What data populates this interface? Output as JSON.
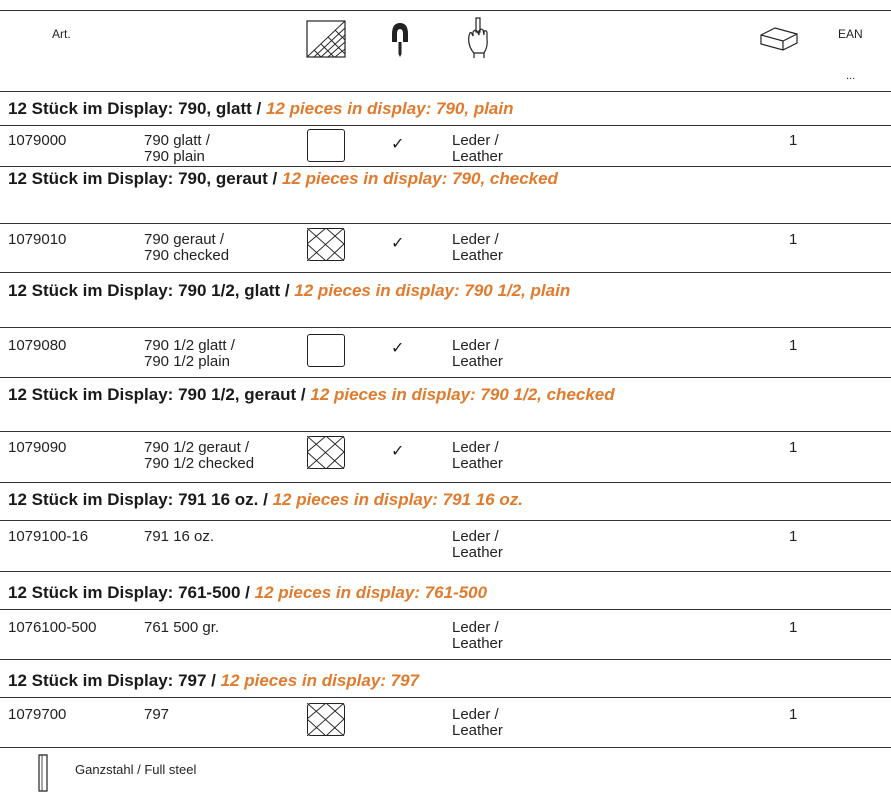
{
  "header": {
    "art_label": "Art.",
    "ean_label": "EAN",
    "ellipsis": "...",
    "icons": [
      "crosshatch-surface-icon",
      "magnet-handle-icon",
      "hand-grip-icon",
      "package-box-icon"
    ]
  },
  "sections": [
    {
      "heading_de": "12 Stück im Display: 790, glatt / ",
      "heading_en": "12 pieces in display: 790, plain",
      "row": {
        "art": "1079000",
        "name1": "790 glatt /",
        "name2": "790 plain",
        "pattern": "plain",
        "check": "✓",
        "mat1": "Leder /",
        "mat2": "Leather",
        "qty": "1"
      }
    },
    {
      "heading_de": "12 Stück im Display: 790, geraut / ",
      "heading_en": "12 pieces in display: 790, checked",
      "row": {
        "art": "1079010",
        "name1": "790 geraut /",
        "name2": "790 checked",
        "pattern": "checked",
        "check": "✓",
        "mat1": "Leder /",
        "mat2": "Leather",
        "qty": "1"
      }
    },
    {
      "heading_de": "12 Stück im Display: 790 1/2, glatt / ",
      "heading_en": "12 pieces in display: 790 1/2, plain",
      "row": {
        "art": "1079080",
        "name1": "790 1/2 glatt /",
        "name2": "790 1/2 plain",
        "pattern": "plain",
        "check": "✓",
        "mat1": "Leder /",
        "mat2": "Leather",
        "qty": "1"
      }
    },
    {
      "heading_de": "12 Stück im Display: 790 1/2, geraut / ",
      "heading_en": "12 pieces in display: 790 1/2, checked",
      "row": {
        "art": "1079090",
        "name1": "790 1/2 geraut /",
        "name2": "790 1/2 checked",
        "pattern": "checked",
        "check": "✓",
        "mat1": "Leder /",
        "mat2": "Leather",
        "qty": "1"
      }
    },
    {
      "heading_de": "12 Stück im Display: 791 16 oz. / ",
      "heading_en": "12 pieces in display: 791 16 oz.",
      "row": {
        "art": "1079100-16",
        "name1": "791 16 oz.",
        "name2": "",
        "pattern": "",
        "check": "",
        "mat1": "Leder /",
        "mat2": "Leather",
        "qty": "1"
      }
    },
    {
      "heading_de": "12 Stück im Display: 761-500 / ",
      "heading_en": "12 pieces in display: 761-500",
      "row": {
        "art": "1076100-500",
        "name1": "761 500 gr.",
        "name2": "",
        "pattern": "",
        "check": "",
        "mat1": "Leder /",
        "mat2": "Leather",
        "qty": "1"
      }
    },
    {
      "heading_de": "12 Stück im Display: 797 / ",
      "heading_en": "12 pieces in display: 797",
      "row": {
        "art": "1079700",
        "name1": "797",
        "name2": "",
        "pattern": "checked",
        "check": "",
        "mat1": "Leder /",
        "mat2": "Leather",
        "qty": "1"
      }
    }
  ],
  "footer": {
    "legend_text": "Ganzstahl / Full steel",
    "legend_icon": "full-steel-icon"
  },
  "colors": {
    "accent_en": "#e07b2e",
    "text": "#1a1a1a",
    "rule": "#333333"
  }
}
